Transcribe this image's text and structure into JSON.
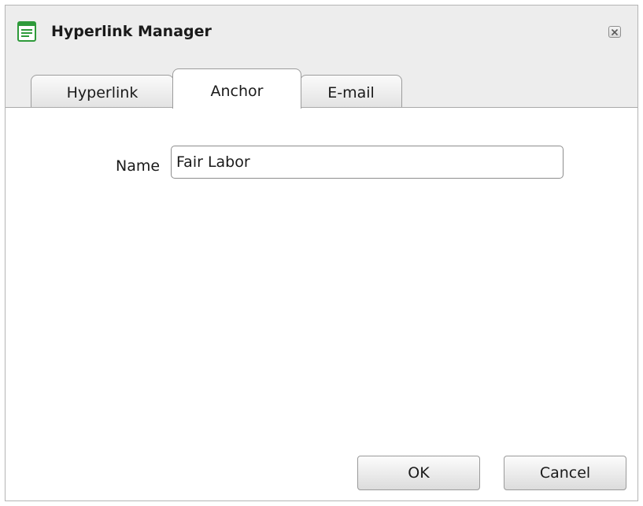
{
  "window": {
    "title": "Hyperlink Manager",
    "app_icon": "document-list-icon",
    "close_icon": "close-icon"
  },
  "tabs": [
    {
      "label": "Hyperlink",
      "active": false
    },
    {
      "label": "Anchor",
      "active": true
    },
    {
      "label": "E-mail",
      "active": false
    }
  ],
  "anchor_panel": {
    "name_label": "Name",
    "name_value": "Fair Labor"
  },
  "buttons": {
    "ok_label": "OK",
    "cancel_label": "Cancel"
  },
  "colors": {
    "titlebar_bg": "#ededed",
    "icon_green": "#2e9a3a"
  }
}
